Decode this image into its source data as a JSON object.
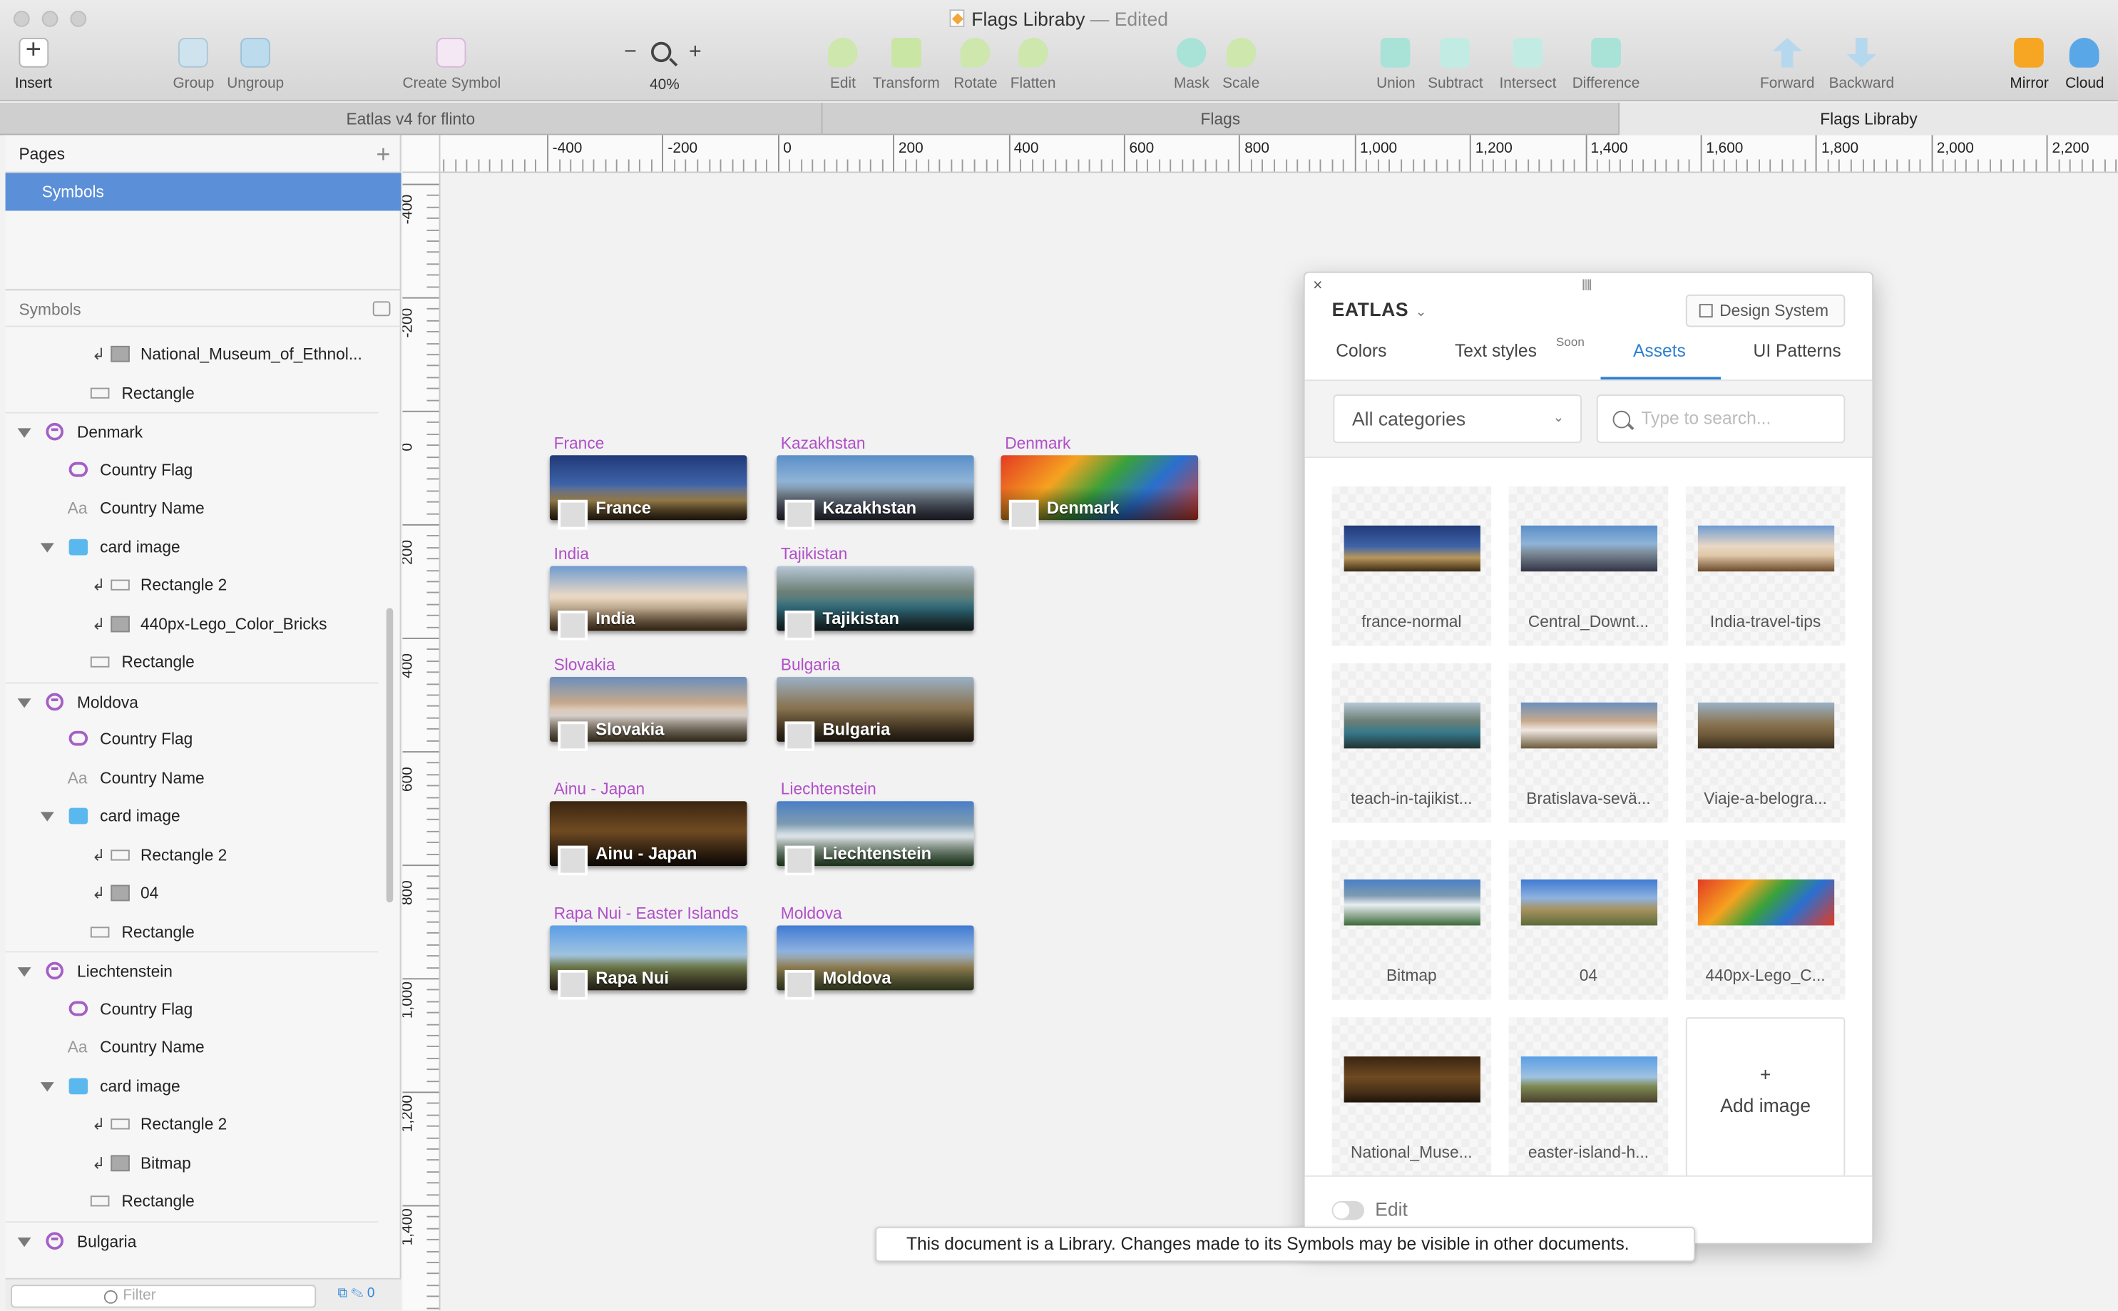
{
  "window": {
    "title": "Flags Libraby",
    "edited_suffix": "— Edited"
  },
  "toolbar": {
    "insert": "Insert",
    "group": "Group",
    "ungroup": "Ungroup",
    "create_symbol": "Create Symbol",
    "zoom_minus": "−",
    "zoom_plus": "+",
    "zoom_level": "40%",
    "edit": "Edit",
    "transform": "Transform",
    "rotate": "Rotate",
    "flatten": "Flatten",
    "mask": "Mask",
    "scale": "Scale",
    "union": "Union",
    "subtract": "Subtract",
    "intersect": "Intersect",
    "difference": "Difference",
    "forward": "Forward",
    "backward": "Backward",
    "mirror": "Mirror",
    "cloud": "Cloud"
  },
  "tabs": [
    {
      "label": "Eatlas v4 for flinto"
    },
    {
      "label": "Flags"
    },
    {
      "label": "Flags Libraby"
    }
  ],
  "sidebar": {
    "pages_header": "Pages",
    "add_page": "+",
    "selected_page": "Symbols",
    "symbols_header": "Symbols",
    "layers": [
      {
        "label": "National_Museum_of_Ethnol..."
      },
      {
        "label": "Rectangle"
      },
      {
        "label": "Denmark"
      },
      {
        "label": "Country Flag"
      },
      {
        "label": "Country Name"
      },
      {
        "label": "card image"
      },
      {
        "label": "Rectangle 2"
      },
      {
        "label": "440px-Lego_Color_Bricks"
      },
      {
        "label": "Rectangle"
      },
      {
        "label": "Moldova"
      },
      {
        "label": "Country Flag"
      },
      {
        "label": "Country Name"
      },
      {
        "label": "card image"
      },
      {
        "label": "Rectangle 2"
      },
      {
        "label": "04"
      },
      {
        "label": "Rectangle"
      },
      {
        "label": "Liechtenstein"
      },
      {
        "label": "Country Flag"
      },
      {
        "label": "Country Name"
      },
      {
        "label": "card image"
      },
      {
        "label": "Rectangle 2"
      },
      {
        "label": "Bitmap"
      },
      {
        "label": "Rectangle"
      },
      {
        "label": "Bulgaria"
      },
      {
        "label": "Country Flag"
      }
    ],
    "text_icon": "Aa",
    "filter_placeholder": "Filter",
    "filter_count": "0"
  },
  "rulers": {
    "horizontal": [
      "-400",
      "-200",
      "0",
      "200",
      "400",
      "600",
      "800",
      "1,000",
      "1,200",
      "1,400",
      "1,600",
      "1,800",
      "2,000",
      "2,200"
    ],
    "vertical": [
      "-400",
      "-200",
      "0",
      "200",
      "400",
      "600",
      "800",
      "1,000",
      "1,200",
      "1,400"
    ]
  },
  "canvas": {
    "cards": [
      {
        "label": "France",
        "name": "France",
        "image": "p-france",
        "flag": "f-fr"
      },
      {
        "label": "Kazakhstan",
        "name": "Kazakhstan",
        "image": "p-kaz",
        "flag": "f-kz"
      },
      {
        "label": "Denmark",
        "name": "Denmark",
        "image": "p-den",
        "flag": "f-dk"
      },
      {
        "label": "India",
        "name": "India",
        "image": "p-ind",
        "flag": "f-in"
      },
      {
        "label": "Tajikistan",
        "name": "Tajikistan",
        "image": "p-taj",
        "flag": "f-tj"
      },
      {
        "label": "Slovakia",
        "name": "Slovakia",
        "image": "p-slo",
        "flag": "f-sk"
      },
      {
        "label": "Bulgaria",
        "name": "Bulgaria",
        "image": "p-bul",
        "flag": "f-bg"
      },
      {
        "label": "Ainu - Japan",
        "name": "Ainu - Japan",
        "image": "p-jap",
        "flag": "f-jp"
      },
      {
        "label": "Liechtenstein",
        "name": "Liechtenstein",
        "image": "p-lie",
        "flag": "f-li"
      },
      {
        "label": "Rapa Nui - Easter Islands",
        "name": "Rapa Nui",
        "image": "p-rap",
        "flag": "f-rn"
      },
      {
        "label": "Moldova",
        "name": "Moldova",
        "image": "p-mol",
        "flag": "f-md"
      }
    ],
    "toast": "This document is a Library. Changes made to its Symbols may be visible in other documents."
  },
  "panel": {
    "close": "×",
    "grip": "|||||",
    "brand": "EATLAS",
    "design_system": "Design System",
    "tabs": {
      "colors": "Colors",
      "text_styles": "Text styles",
      "soon": "Soon",
      "assets": "Assets",
      "ui_patterns": "UI Patterns"
    },
    "category_select": "All categories",
    "search_placeholder": "Type to search...",
    "assets": [
      {
        "name": "france-normal",
        "image": "p-france"
      },
      {
        "name": "Central_Downt...",
        "image": "p-kaz"
      },
      {
        "name": "India-travel-tips",
        "image": "p-ind"
      },
      {
        "name": "teach-in-tajikist...",
        "image": "p-taj"
      },
      {
        "name": "Bratislava-sevä...",
        "image": "p-slo"
      },
      {
        "name": "Viaje-a-belogra...",
        "image": "p-bul"
      },
      {
        "name": "Bitmap",
        "image": "p-lie"
      },
      {
        "name": "04",
        "image": "p-mol"
      },
      {
        "name": "440px-Lego_C...",
        "image": "p-den"
      },
      {
        "name": "National_Muse...",
        "image": "p-jap"
      },
      {
        "name": "easter-island-h...",
        "image": "p-rap"
      }
    ],
    "add_plus": "+",
    "add_image": "Add image",
    "edit_label": "Edit",
    "edit_toggle_on": false
  },
  "colors": {
    "selection": "#5b8fd8",
    "symbol_purple": "#b04fc8",
    "accent_blue": "#2e7fd0"
  }
}
